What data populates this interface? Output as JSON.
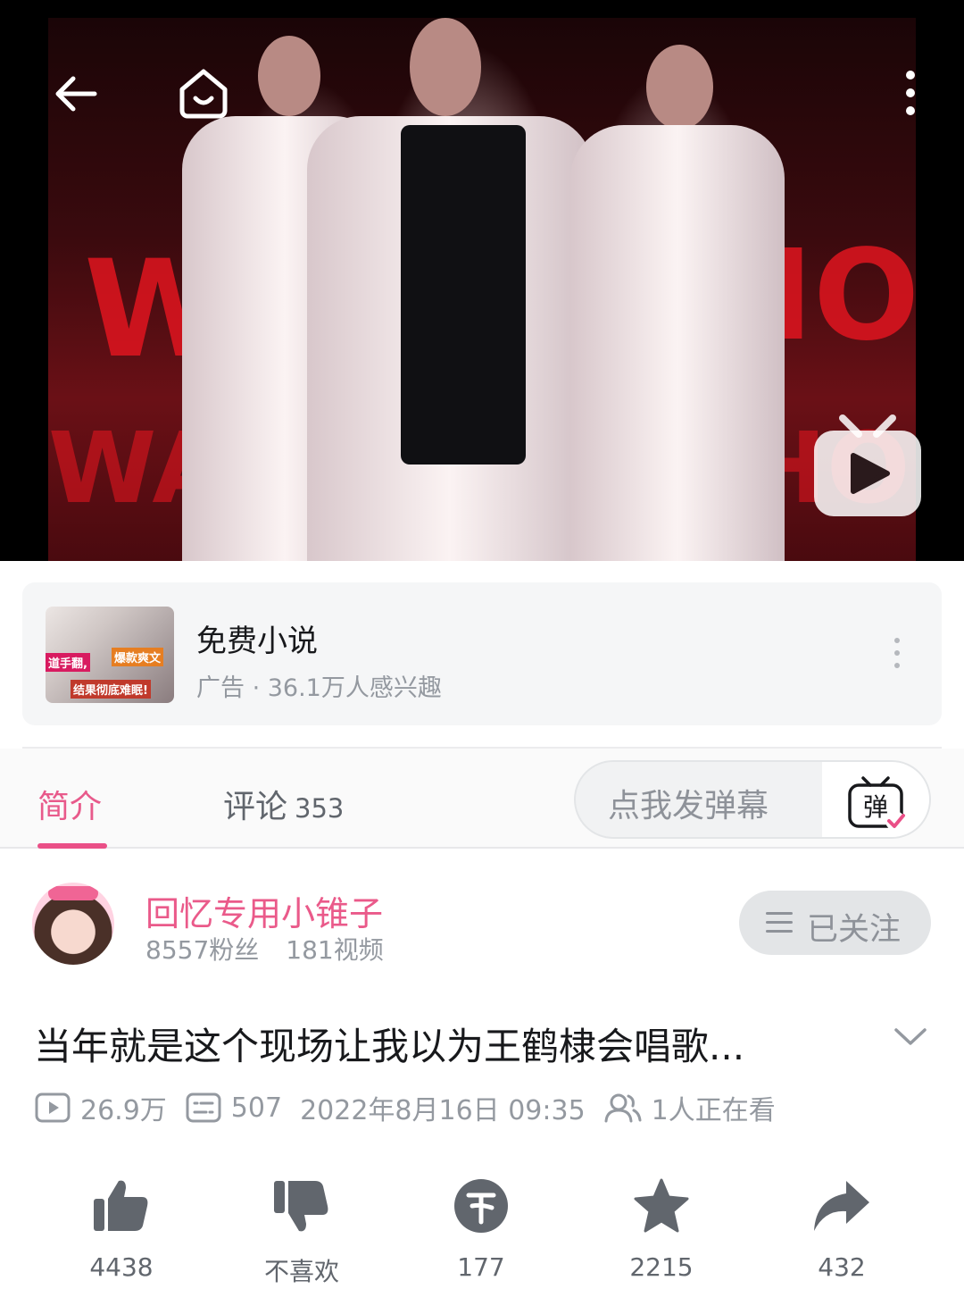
{
  "player": {
    "back_icon": "arrow-left-icon",
    "home_icon": "home-smile-icon",
    "more_icon": "more-vertical-icon",
    "watermark_icon": "bilibili-tv-play-icon",
    "stage_text": [
      "WA",
      "HOI",
      "WAN",
      "HOI"
    ]
  },
  "ad": {
    "title": "免费小说",
    "subtitle": "广告 · 36.1万人感兴趣",
    "thumb_texts": [
      "道手翻,",
      "爆款爽文",
      "结果彻底难眠!"
    ]
  },
  "tabs": {
    "intro": "简介",
    "comments": "评论",
    "comments_count": "353",
    "danmaku_placeholder": "点我发弹幕",
    "danmaku_icon": "danmaku-toggle-icon"
  },
  "uploader": {
    "name": "回忆专用小锥子",
    "fans": "8557粉丝",
    "videos": "181视频",
    "follow_label": "已关注"
  },
  "video": {
    "title": "当年就是这个现场让我以为王鹤棣会唱歌...",
    "views": "26.9万",
    "danmaku_count": "507",
    "published": "2022年8月16日 09:35",
    "watching": "1人正在看"
  },
  "actions": {
    "like": "4438",
    "dislike": "不喜欢",
    "coin": "177",
    "favorite": "2215",
    "share": "432"
  },
  "colors": {
    "accent_pink": "#ea4f87",
    "text_primary": "#18191c",
    "text_secondary": "#9499a0",
    "icon_gray": "#61666d"
  }
}
